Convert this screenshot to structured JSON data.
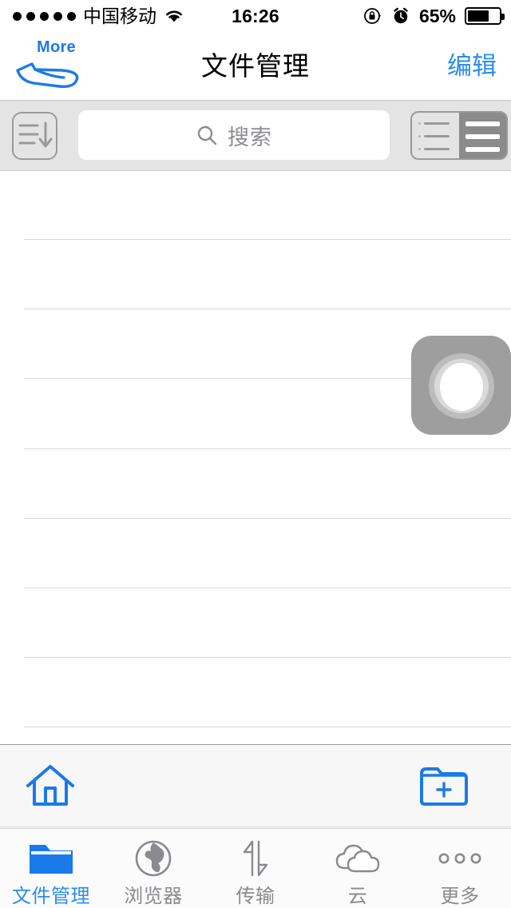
{
  "status_bar": {
    "signal_dots": 5,
    "carrier": "中国移动",
    "wifi_icon": "wifi-icon",
    "time": "16:26",
    "rotation_lock_icon": "rotation-lock-icon",
    "alarm_icon": "alarm-clock-icon",
    "battery_percent": "65%",
    "battery_level": 65
  },
  "nav_bar": {
    "more_label": "More",
    "more_icon": "swipe-hand-icon",
    "title": "文件管理",
    "edit_label": "编辑",
    "accent_color": "#2a8cf0"
  },
  "search_bar": {
    "sort_icon": "sort-descending-icon",
    "search_icon": "search-icon",
    "placeholder": "搜索",
    "value": "",
    "view_modes": [
      {
        "name": "detail-list-view",
        "selected": false
      },
      {
        "name": "simple-list-view",
        "selected": true
      }
    ]
  },
  "file_list": {
    "items": [],
    "row_count": 9,
    "loading_indicator": "activity-spinner"
  },
  "toolbar": {
    "home_icon": "home-icon",
    "new_folder_icon": "new-folder-icon",
    "icon_color": "#1a7ae8"
  },
  "tab_bar": {
    "tabs": [
      {
        "label": "文件管理",
        "icon": "folder-icon",
        "active": true
      },
      {
        "label": "浏览器",
        "icon": "globe-icon",
        "active": false
      },
      {
        "label": "传输",
        "icon": "transfer-icon",
        "active": false
      },
      {
        "label": "云",
        "icon": "cloud-icon",
        "active": false
      },
      {
        "label": "更多",
        "icon": "more-dots-icon",
        "active": false
      }
    ],
    "active_color": "#2a8cf0",
    "inactive_color": "#8a8a8f"
  }
}
